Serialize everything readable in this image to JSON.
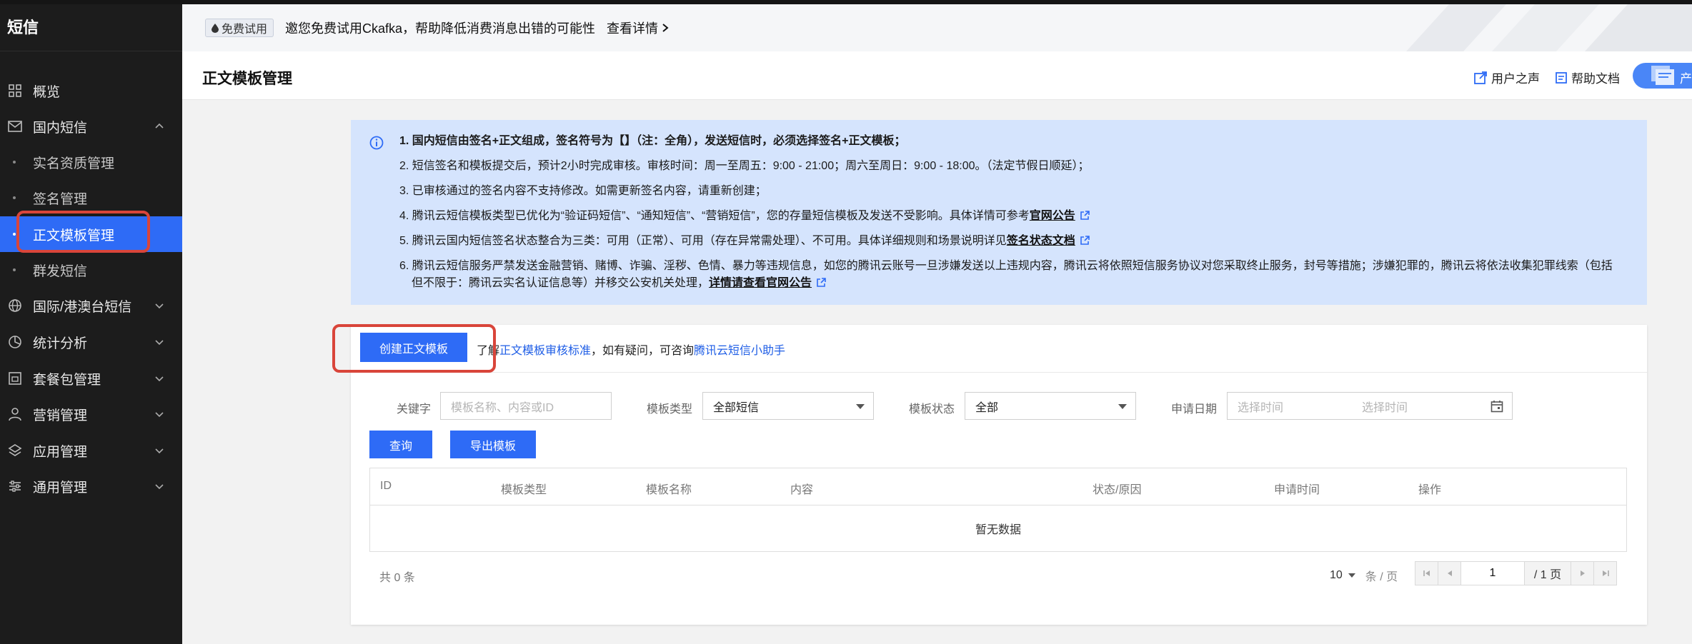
{
  "app": {
    "title": "短信"
  },
  "sidebar": {
    "items": [
      {
        "label": "概览",
        "icon": "grid-icon"
      },
      {
        "label": "国内短信",
        "icon": "mail-icon",
        "expanded": true
      },
      {
        "label": "实名资质管理",
        "sub": true
      },
      {
        "label": "签名管理",
        "sub": true
      },
      {
        "label": "正文模板管理",
        "sub": true,
        "active": true
      },
      {
        "label": "群发短信",
        "sub": true
      },
      {
        "label": "国际/港澳台短信",
        "icon": "globe-icon"
      },
      {
        "label": "统计分析",
        "icon": "pie-chart-icon"
      },
      {
        "label": "套餐包管理",
        "icon": "package-icon"
      },
      {
        "label": "营销管理",
        "icon": "user-icon"
      },
      {
        "label": "应用管理",
        "icon": "layers-icon"
      },
      {
        "label": "通用管理",
        "icon": "sliders-icon"
      }
    ]
  },
  "banner": {
    "badge": "免费试用",
    "message": "邀您免费试用Ckafka，帮助降低消费消息出错的可能性",
    "more": "查看详情"
  },
  "header": {
    "title": "正文模板管理",
    "feedback": "用户之声",
    "help": "帮助文档",
    "pill": "产"
  },
  "notice": {
    "items": [
      "1. 国内短信由签名+正文组成，签名符号为【】（注：全角），发送短信时，必须选择签名+正文模板；",
      "2. 短信签名和模板提交后，预计2小时完成审核。审核时间：周一至周五：9:00 - 21:00；周六至周日：9:00 - 18:00。（法定节假日顺延）；",
      "3. 已审核通过的签名内容不支持修改。如需更新签名内容，请重新创建；",
      "4. 腾讯云短信模板类型已优化为“验证码短信”、“通知短信”、“营销短信”，您的存量短信模板及发送不受影响。具体详情可参考",
      "5. 腾讯云国内短信签名状态整合为三类：可用（正常）、可用（存在异常需处理）、不可用。具体详细规则和场景说明详见",
      "6. 腾讯云短信服务严禁发送金融营销、赌博、诈骗、淫秽、色情、暴力等违规信息，如您的腾讯云账号一旦涉嫌发送以上违规内容，腾讯云将依照短信服务协议对您采取终止服务，封号等措施；涉嫌犯罪的，腾讯云将依法收集犯罪线索（包括但不限于：腾讯云实名认证信息等）并移交公安机关处理，"
    ],
    "link4": "官网公告",
    "link5": "签名状态文档",
    "link6": "详情请查看官网公告"
  },
  "toolbar": {
    "create_label": "创建正文模板",
    "tip_prefix": "了解",
    "tip_link1": "正文模板审核标准",
    "tip_mid": "，如有疑问，可咨询",
    "tip_link2": "腾讯云短信小助手"
  },
  "filters": {
    "keyword_label": "关键字",
    "keyword_placeholder": "模板名称、内容或ID",
    "type_label": "模板类型",
    "type_value": "全部短信",
    "status_label": "模板状态",
    "status_value": "全部",
    "date_label": "申请日期",
    "date_start_placeholder": "选择时间",
    "date_end_placeholder": "选择时间",
    "query_label": "查询",
    "export_label": "导出模板"
  },
  "table": {
    "columns": [
      "ID",
      "模板类型",
      "模板名称",
      "内容",
      "状态/原因",
      "申请时间",
      "操作"
    ],
    "empty_text": "暂无数据"
  },
  "pagination": {
    "total_text": "共 0 条",
    "page_size": "10",
    "page_size_unit": "条 / 页",
    "current_page": "1",
    "total_pages": "/ 1 页"
  },
  "colors": {
    "primary": "#2e6bf6",
    "sidebar_bg": "#1c1c1c",
    "notice_bg": "#d5e4fd",
    "highlight": "#d9453a"
  }
}
